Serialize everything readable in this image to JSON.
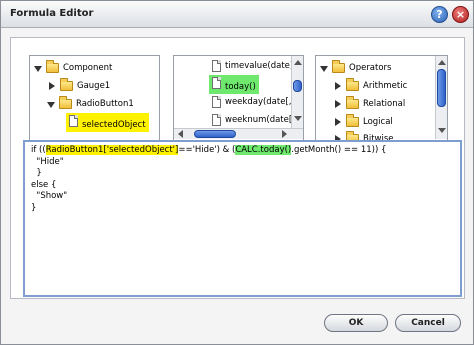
{
  "window": {
    "title": "Formula Editor"
  },
  "component_tree": {
    "root": "Component",
    "items": [
      "Gauge1",
      "RadioButton1",
      "selectedObject"
    ]
  },
  "function_list": {
    "items": [
      "timevalue(date)",
      "today()",
      "weekday(date[, r",
      "weeknum(date[, r"
    ]
  },
  "operator_tree": {
    "root": "Operators",
    "items": [
      "Arithmetic",
      "Relational",
      "Logical",
      "Bitwise"
    ]
  },
  "formula": {
    "line1_pre": "if ((",
    "line1_hl1": "RadioButton1['selectedObject']",
    "line1_mid": "=='Hide') & (",
    "line1_hl2": "CALC.today()",
    "line1_post": ".getMonth() == 11)) {",
    "line2": "  \"Hide\"",
    "line3": "  }",
    "line4": "else {",
    "line5": "  \"Show\"",
    "line6": "}"
  },
  "buttons": {
    "ok": "OK",
    "cancel": "Cancel"
  },
  "colors": {
    "highlight_yellow": "#fff200",
    "highlight_green": "#6ee96e",
    "scroll_thumb": "#2f63cb"
  }
}
